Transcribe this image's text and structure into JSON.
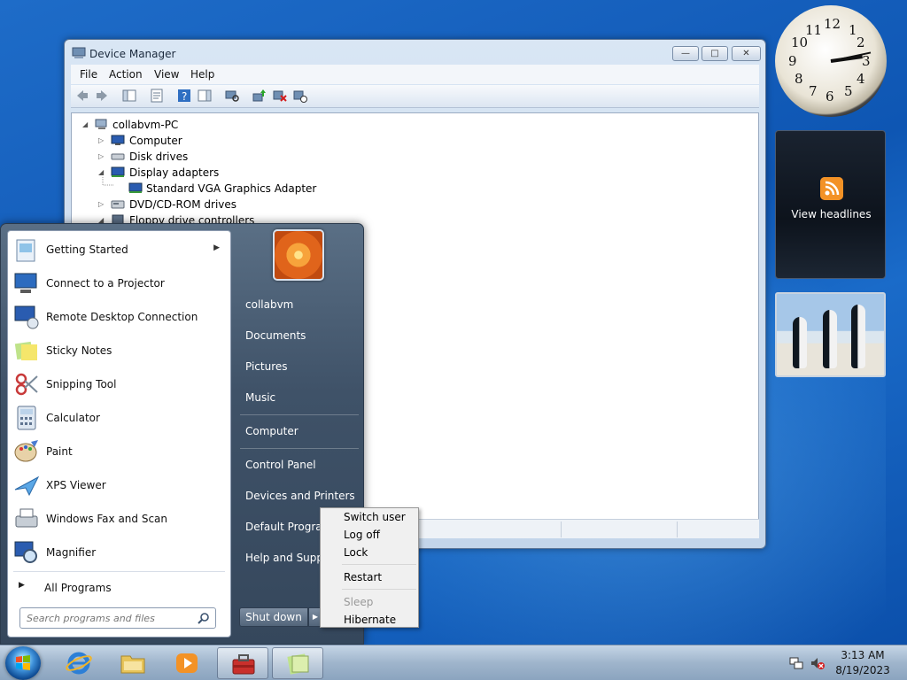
{
  "device_manager": {
    "title": "Device Manager",
    "menu": [
      "File",
      "Action",
      "View",
      "Help"
    ],
    "tree": {
      "root": "collabvm-PC",
      "nodes": [
        "Computer",
        "Disk drives",
        "Display adapters",
        "Standard VGA Graphics Adapter",
        "DVD/CD-ROM drives",
        "Floppy drive controllers"
      ]
    }
  },
  "start_menu": {
    "programs": [
      {
        "label": "Getting Started",
        "has_submenu": true,
        "icon": "getting-started-icon"
      },
      {
        "label": "Connect to a Projector",
        "icon": "projector-icon"
      },
      {
        "label": "Remote Desktop Connection",
        "icon": "remote-desktop-icon"
      },
      {
        "label": "Sticky Notes",
        "icon": "sticky-notes-icon"
      },
      {
        "label": "Snipping Tool",
        "icon": "scissors-icon"
      },
      {
        "label": "Calculator",
        "icon": "calculator-icon"
      },
      {
        "label": "Paint",
        "icon": "paint-palette-icon"
      },
      {
        "label": "XPS Viewer",
        "icon": "xps-viewer-icon"
      },
      {
        "label": "Windows Fax and Scan",
        "icon": "fax-icon"
      },
      {
        "label": "Magnifier",
        "icon": "magnifier-icon"
      }
    ],
    "all_programs": "All Programs",
    "search_placeholder": "Search programs and files",
    "right": {
      "user": "collabvm",
      "documents": "Documents",
      "pictures": "Pictures",
      "music": "Music",
      "computer": "Computer",
      "control_panel": "Control Panel",
      "devices_printers": "Devices and Printers",
      "default_programs": "Default Programs",
      "help_support": "Help and Support"
    },
    "shutdown_label": "Shut down"
  },
  "shutdown_menu": {
    "switch_user": "Switch user",
    "log_off": "Log off",
    "lock": "Lock",
    "restart": "Restart",
    "sleep": "Sleep",
    "hibernate": "Hibernate"
  },
  "gadgets": {
    "clock_numbers": [
      "12",
      "1",
      "2",
      "3",
      "4",
      "5",
      "6",
      "7",
      "8",
      "9",
      "10",
      "11"
    ],
    "feed_label": "View headlines"
  },
  "taskbar": {
    "time": "3:13 AM",
    "date": "8/19/2023"
  },
  "colors": {
    "desktop": "#1660bd",
    "start_menu_frame": "#3f5268",
    "feed_orange": "#f39226"
  }
}
